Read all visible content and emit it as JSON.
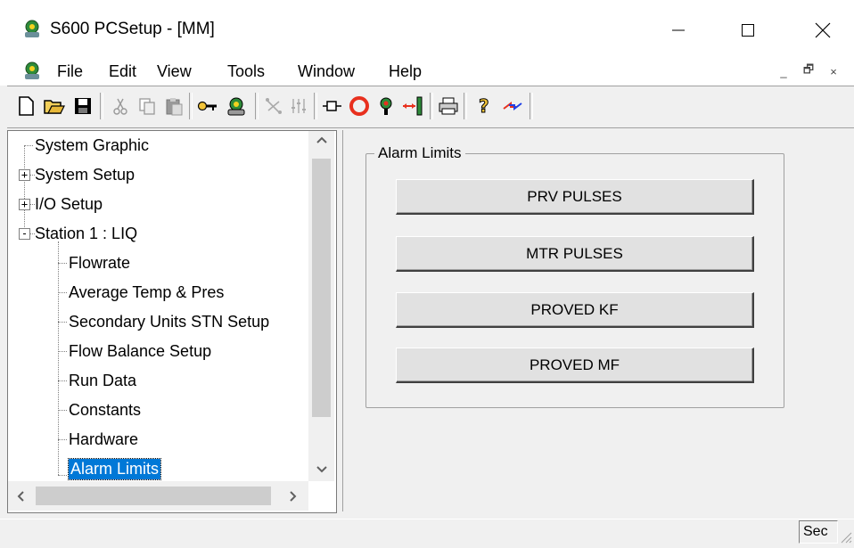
{
  "window": {
    "title": "S600 PCSetup  - [MM]",
    "icons": {
      "app": "s600-app-icon",
      "minimize": "minimize-icon",
      "maximize": "maximize-icon",
      "close": "close-icon"
    }
  },
  "menubar": {
    "items": [
      "File",
      "Edit",
      "View",
      "Tools",
      "Window",
      "Help"
    ]
  },
  "mdi_controls": [
    "_",
    "🗗",
    "×"
  ],
  "toolbar": {
    "buttons": [
      "new-file-icon",
      "open-folder-icon",
      "save-icon",
      "cut-icon",
      "copy-icon",
      "paste-icon",
      "key-icon",
      "connect-icon",
      "network-icon",
      "mixer-icon",
      "disconnect-box-icon",
      "stop-icon",
      "tree-icon",
      "transfer-icon",
      "print-icon",
      "help-icon",
      "swap-arrows-icon"
    ]
  },
  "tree": {
    "items": [
      {
        "label": "System Graphic",
        "level": 0,
        "expander": ""
      },
      {
        "label": "System Setup",
        "level": 0,
        "expander": "+"
      },
      {
        "label": "I/O Setup",
        "level": 0,
        "expander": "+"
      },
      {
        "label": "Station 1 : LIQ",
        "level": 0,
        "expander": "-"
      },
      {
        "label": "Flowrate",
        "level": 1,
        "expander": ""
      },
      {
        "label": "Average Temp & Pres",
        "level": 1,
        "expander": ""
      },
      {
        "label": "Secondary Units STN Setup",
        "level": 1,
        "expander": ""
      },
      {
        "label": "Flow Balance Setup",
        "level": 1,
        "expander": ""
      },
      {
        "label": "Run Data",
        "level": 1,
        "expander": ""
      },
      {
        "label": "Constants",
        "level": 1,
        "expander": ""
      },
      {
        "label": "Hardware",
        "level": 1,
        "expander": ""
      },
      {
        "label": "Alarm Limits",
        "level": 1,
        "expander": "",
        "selected": true
      }
    ]
  },
  "alarm_limits": {
    "group_title": "Alarm Limits",
    "buttons": [
      "PRV PULSES",
      "MTR PULSES",
      "PROVED KF",
      "PROVED MF"
    ]
  },
  "statusbar": {
    "panel_text": "Sec"
  }
}
